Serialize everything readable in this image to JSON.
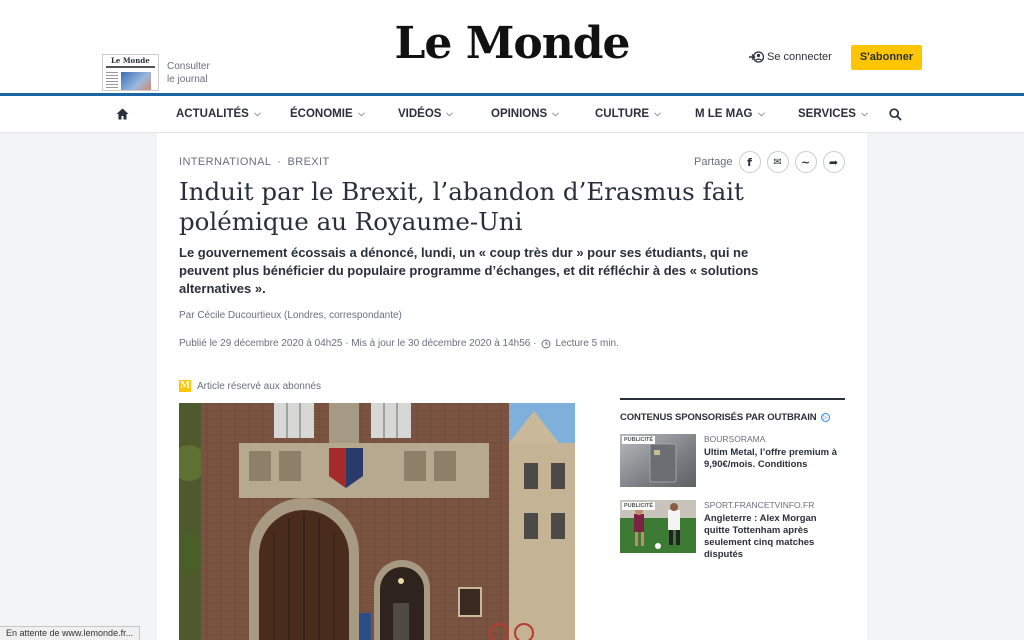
{
  "header": {
    "logo": "Le Monde",
    "paper_thumb_title": "Le Monde",
    "consult_line1": "Consulter",
    "consult_line2": "le journal",
    "login": "Se connecter",
    "subscribe": "S'abonner"
  },
  "nav": {
    "items": [
      {
        "label": "ACTUALITÉS"
      },
      {
        "label": "ÉCONOMIE"
      },
      {
        "label": "VIDÉOS"
      },
      {
        "label": "OPINIONS"
      },
      {
        "label": "CULTURE"
      },
      {
        "label": "M LE MAG"
      },
      {
        "label": "SERVICES"
      }
    ]
  },
  "article": {
    "breadcrumb": [
      "INTERNATIONAL",
      "BREXIT"
    ],
    "breadcrumb_sep": "·",
    "share_label": "Partage",
    "share_buttons": [
      "f",
      "✉",
      "~",
      "➦"
    ],
    "headline": "Induit par le Brexit, l’abandon d’Erasmus fait polémique au Royaume-Uni",
    "lead": "Le gouvernement écossais a dénoncé, lundi, un « coup très dur » pour ses étudiants, qui ne peuvent plus bénéficier du populaire programme d’échanges, et dit réfléchir à des « solutions alternatives ».",
    "byline": "Par Cécile Ducourtieux (Londres, correspondante)",
    "dates": "Publié le 29 décembre 2020 à 04h25 · Mis à jour le 30 décembre 2020 à 14h56 ·",
    "reading_time": "Lecture 5 min.",
    "reserved": "Article réservé aux abonnés",
    "reserved_icon": "M"
  },
  "outbrain": {
    "title": "CONTENUS SPONSORISÉS PAR OUTBRAIN",
    "info_glyph": "▷",
    "cards": [
      {
        "badge": "PUBLICITÉ",
        "source": "BOURSORAMA",
        "text": "Ultim Metal, l’offre premium à 9,90€/mois. Conditions"
      },
      {
        "badge": "PUBLICITÉ",
        "source": "SPORT.FRANCETVINFO.FR",
        "text": "Angleterre : Alex Morgan quitte Tottenham après seulement cinq matches disputés"
      }
    ]
  },
  "status_bar": "En attente de www.lemonde.fr..."
}
